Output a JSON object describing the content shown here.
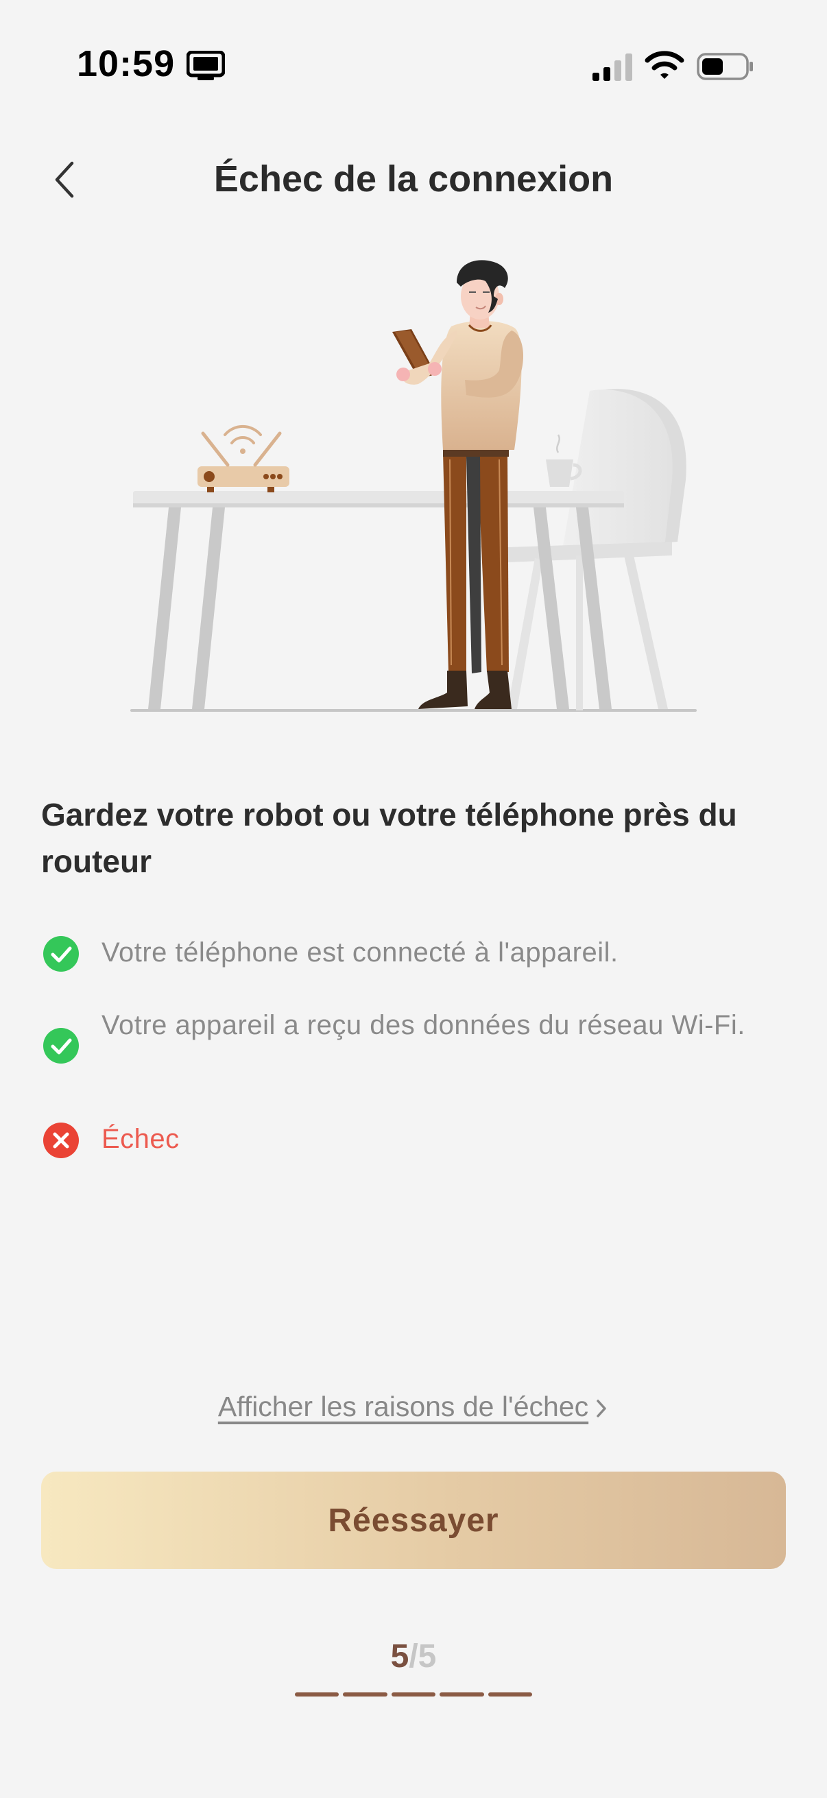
{
  "status_bar": {
    "time": "10:59",
    "icons": [
      "screen-mirror-icon",
      "cellular-signal-icon",
      "wifi-icon",
      "battery-icon"
    ]
  },
  "nav": {
    "back_icon": "chevron-left-icon",
    "title": "Échec de la connexion"
  },
  "illustration": {
    "description_icon": "person-with-tablet-router-illustration"
  },
  "headline": "Gardez votre robot ou votre téléphone près du routeur",
  "checklist": [
    {
      "status": "success",
      "icon": "check-circle-icon",
      "text": "Votre téléphone est connecté à l'appareil."
    },
    {
      "status": "success",
      "icon": "check-circle-icon",
      "text": "Votre appareil a reçu des données du réseau Wi-Fi."
    },
    {
      "status": "failed",
      "icon": "error-circle-icon",
      "text": "Échec"
    }
  ],
  "reasons_link": {
    "label": "Afficher les raisons de l'échec",
    "icon": "chevron-right-icon"
  },
  "retry_button": {
    "label": "Réessayer"
  },
  "step": {
    "current": "5",
    "separator": "/",
    "total": "5"
  },
  "colors": {
    "background": "#f4f4f4",
    "success": "#34c759",
    "error": "#ea4335",
    "accent_text": "#7a4c32",
    "button_gradient_start": "#f7e8c0",
    "button_gradient_end": "#d7b896"
  }
}
